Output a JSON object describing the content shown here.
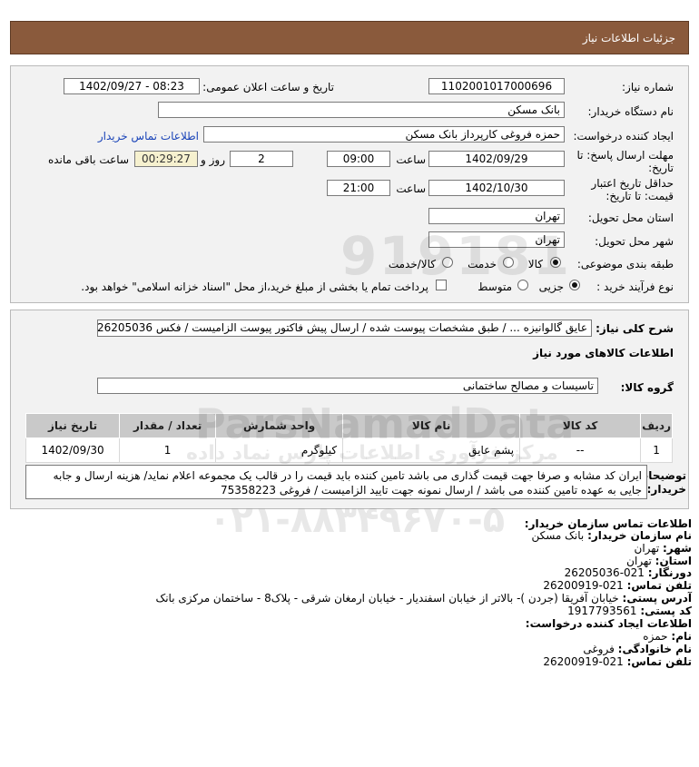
{
  "header": {
    "title": "جزئیات اطلاعات نیاز"
  },
  "form": {
    "need_number_label": "شماره نیاز:",
    "need_number": "1102001017000696",
    "announce_label": "تاریخ و ساعت اعلان عمومی:",
    "announce_value": "1402/09/27 - 08:23",
    "buyer_org_label": "نام دستگاه خریدار:",
    "buyer_org": "بانک مسکن",
    "creator_label": "ایجاد کننده درخواست:",
    "creator": "حمزه فروغی کارپرداز بانک مسکن",
    "contact_link": "اطلاعات تماس خریدار",
    "deadline_label_1": "مهلت ارسال پاسخ: تا",
    "deadline_label_2": "تاریخ:",
    "deadline_date": "1402/09/29",
    "time_label": "ساعت",
    "deadline_time": "09:00",
    "days": "2",
    "days_label": "روز و",
    "timer": "00:29:27",
    "remaining_label": "ساعت باقی مانده",
    "validity_label_1": "حداقل تاریخ اعتبار",
    "validity_label_2": "قیمت: تا تاریخ:",
    "validity_date": "1402/10/30",
    "validity_time": "21:00",
    "province_label": "استان محل تحویل:",
    "province": "تهران",
    "city_label": "شهر محل تحویل:",
    "city": "تهران",
    "category_label": "طبقه بندی موضوعی:",
    "category_options": [
      "کالا",
      "خدمت",
      "کالا/خدمت"
    ],
    "process_label": "نوع فرآیند خرید :",
    "process_options": [
      "جزیی",
      "متوسط"
    ],
    "payment_note": "پرداخت تمام یا بخشی از مبلغ خرید،از محل \"اسناد خزانه اسلامی\" خواهد بود."
  },
  "details": {
    "summary_label": "شرح کلی نیاز:",
    "summary": "عایق گالوانیزه ... / طبق مشخصات پیوست شده / ارسال پیش فاکتور پیوست الزامیست / فکس 26205036",
    "goods_info_label": "اطلاعات کالاهای مورد نیاز",
    "goods_group_label": "گروه کالا:",
    "goods_group": "تاسیسات و مصالح ساختمانی",
    "table": {
      "headers": [
        "ردیف",
        "کد کالا",
        "نام کالا",
        "واحد شمارش",
        "تعداد / مقدار",
        "تاریخ نیاز"
      ],
      "rows": [
        [
          "1",
          "--",
          "پشم عایق",
          "کیلوگرم",
          "1",
          "1402/09/30"
        ]
      ]
    },
    "buyer_notes_label_1": "توضیحات",
    "buyer_notes_label_2": "خریدار:",
    "buyer_notes": "ایران کد مشابه و صرفا جهت قیمت گذاری می باشد تامین کننده باید قیمت را در قالب یک مجموعه اعلام نماید/ هزینه ارسال و جابه جایی به عهده تامین کننده می باشد / ارسال نمونه جهت تایید الزامیست / فروغی 75358223"
  },
  "contact": {
    "heading": "اطلاعات تماس سازمان خریدار:",
    "org_label": "نام سازمان خریدار:",
    "org": "بانک مسکن",
    "city_label": "شهر:",
    "city": "تهران",
    "province_label": "استان:",
    "province": "تهران",
    "fax_label": "دورنگار:",
    "fax": "021-26205036",
    "phone_label": "تلفن تماس:",
    "phone": "021-26200919",
    "address_label": "آدرس پستی:",
    "address": "خیابان آفریقا (جردن )- بالاتر از خیابان اسفندیار - خیابان ارمغان شرقی - پلاک8 - ساختمان مرکزی بانک",
    "postal_label": "کد پستی:",
    "postal": "1917793561",
    "creator_heading": "اطلاعات ایجاد کننده درخواست:",
    "name_label": "نام:",
    "name": "حمزه",
    "family_label": "نام خانوادگی:",
    "family": "فروغی",
    "creator_phone_label": "تلفن تماس:",
    "creator_phone": "021-26200919"
  },
  "watermark": {
    "number": "919181",
    "brand": "ParsNamadData",
    "persian": "مرکز فرآوری اطلاعات پارس نماد داده",
    "phone": "۰۲۱-۸۸۳۴۹۶۷۰-۵"
  }
}
